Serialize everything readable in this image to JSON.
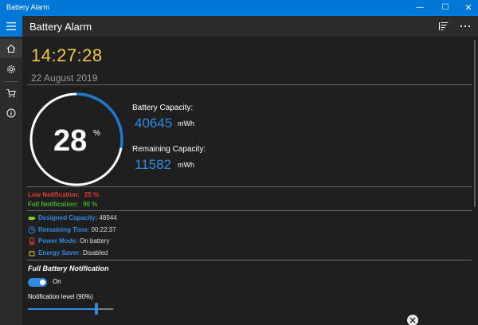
{
  "window": {
    "title": "Battery Alarm",
    "minimize_glyph": "—",
    "maximize_glyph": "☐",
    "close_glyph": "✕"
  },
  "header": {
    "app_title": "Battery Alarm",
    "icons": [
      "filter-list-icon",
      "more-icon"
    ]
  },
  "sidebar": {
    "items": [
      {
        "name": "home",
        "icon": "home-icon",
        "active": true
      },
      {
        "name": "settings",
        "icon": "gear-icon",
        "active": false
      },
      {
        "name": "store",
        "icon": "cart-icon",
        "active": false
      },
      {
        "name": "about",
        "icon": "info-icon",
        "active": false
      }
    ]
  },
  "clock": {
    "time": "14:27:28",
    "date": "22 August 2019"
  },
  "battery": {
    "percent": 28,
    "percent_text": "28",
    "percent_sign": "%",
    "capacity_label": "Battery Capacity:",
    "capacity_value": "40645",
    "capacity_unit": "mWh",
    "remaining_label": "Remaining Capacity:",
    "remaining_value": "11582",
    "remaining_unit": "mWh"
  },
  "notifications": {
    "low_label": "Low Notification:",
    "low_value": "25 %",
    "full_label": "Full Notification:",
    "full_value": "90 %"
  },
  "info": {
    "designed_label": "Designed Capacity:",
    "designed_value": "48944",
    "remaining_time_label": "Remaining Time:",
    "remaining_time_value": "00:22:37",
    "power_mode_label": "Power Mode:",
    "power_mode_value": "On battery",
    "energy_saver_label": "Energy Saver:",
    "energy_saver_value": "Disabled"
  },
  "full_battery": {
    "section_title": "Full Battery Notification",
    "toggle_on": true,
    "toggle_label": "On",
    "level_label": "Notification level (90%)",
    "level": 0.8
  },
  "colors": {
    "accent": "#0078d7",
    "clock": "#f0c74a",
    "value_blue": "#2f8ae0",
    "low": "#e53935",
    "full": "#43b02a"
  }
}
